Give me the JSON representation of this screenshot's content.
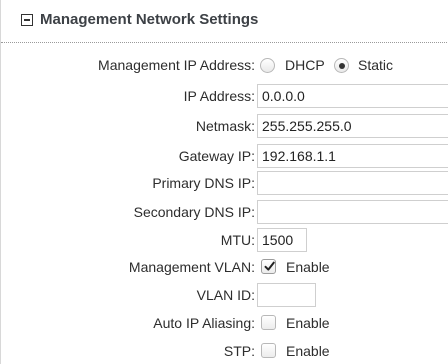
{
  "section": {
    "title": "Management Network Settings"
  },
  "ip_mode": {
    "label": "Management IP Address:",
    "options": [
      {
        "label": "DHCP",
        "selected": false
      },
      {
        "label": "Static",
        "selected": true
      }
    ]
  },
  "ip_address": {
    "label": "IP Address:",
    "value": "0.0.0.0"
  },
  "netmask": {
    "label": "Netmask:",
    "value": "255.255.255.0"
  },
  "gateway": {
    "label": "Gateway IP:",
    "value": "192.168.1.1"
  },
  "primary_dns": {
    "label": "Primary DNS IP:",
    "value": ""
  },
  "secondary_dns": {
    "label": "Secondary DNS IP:",
    "value": ""
  },
  "mtu": {
    "label": "MTU:",
    "value": "1500"
  },
  "mgmt_vlan": {
    "label": "Management VLAN:",
    "option": "Enable",
    "checked": true
  },
  "vlan_id": {
    "label": "VLAN ID:",
    "value": ""
  },
  "auto_ip_aliasing": {
    "label": "Auto IP Aliasing:",
    "option": "Enable",
    "checked": false
  },
  "stp": {
    "label": "STP:",
    "option": "Enable",
    "checked": false
  }
}
